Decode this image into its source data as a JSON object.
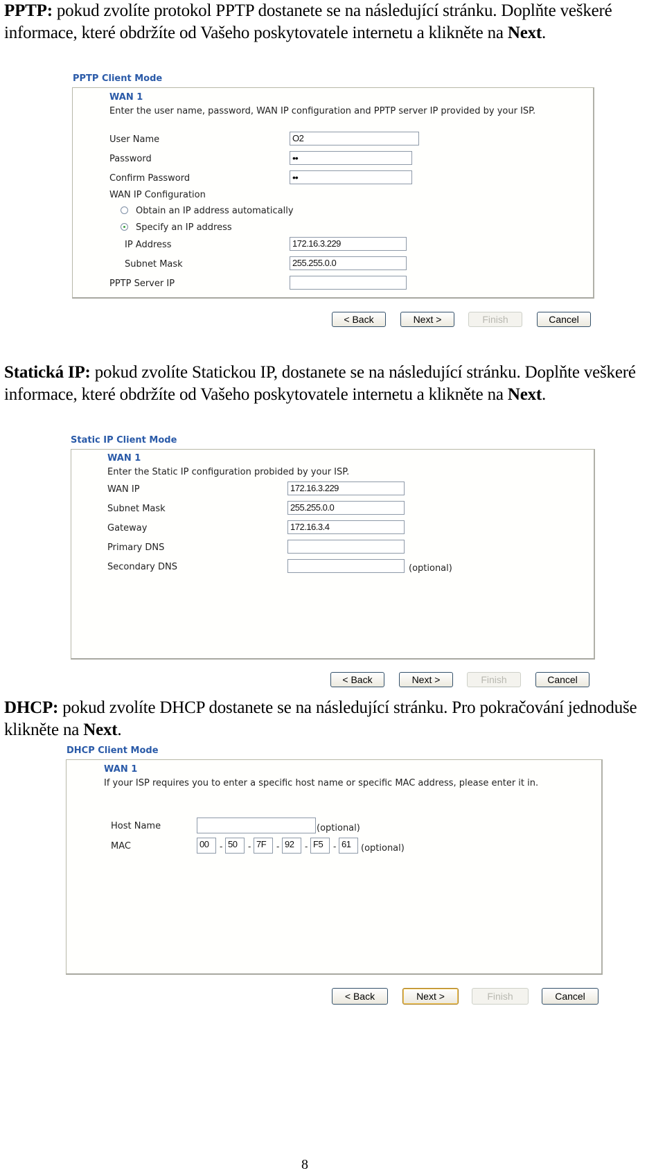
{
  "sections": {
    "pptp": {
      "intro_bold": "PPTP:",
      "intro_text_1": " pokud zvolíte protokol PPTP dostanete se na následující stránku. Doplňte veškeré informace, které obdržíte od Vašeho poskytovatele internetu a klikněte na ",
      "intro_next_bold": "Next",
      "intro_end": ".",
      "panel_title": "PPTP Client Mode",
      "wan_label": "WAN 1",
      "instructions": "Enter the user name, password, WAN IP configuration and PPTP server IP provided by your ISP.",
      "fields": {
        "user_name": {
          "label": "User Name",
          "value": "O2"
        },
        "password": {
          "label": "Password",
          "value": "••"
        },
        "confirm_password": {
          "label": "Confirm Password",
          "value": "••"
        },
        "wan_ip_config_label": "WAN IP Configuration",
        "radio_auto": {
          "label": "Obtain an IP address automatically",
          "selected": false
        },
        "radio_specify": {
          "label": "Specify an IP address",
          "selected": true
        },
        "ip_address": {
          "label": "IP Address",
          "value": "172.16.3.229"
        },
        "subnet_mask": {
          "label": "Subnet Mask",
          "value": "255.255.0.0"
        },
        "pptp_server_ip": {
          "label": "PPTP Server IP",
          "value": ""
        }
      },
      "buttons": {
        "back": "< Back",
        "next": "Next >",
        "finish": "Finish",
        "cancel": "Cancel"
      }
    },
    "static": {
      "intro_bold": "Statická IP:",
      "intro_text_1": " pokud zvolíte Statickou IP, dostanete se na následující stránku. Doplňte veškeré informace, které obdržíte od Vašeho poskytovatele internetu a klikněte na ",
      "intro_next_bold": "Next",
      "intro_end": ".",
      "panel_title": "Static IP Client Mode",
      "wan_label": "WAN 1",
      "instructions": "Enter the Static IP configuration probided by your ISP.",
      "fields": {
        "wan_ip": {
          "label": "WAN IP",
          "value": "172.16.3.229"
        },
        "subnet_mask": {
          "label": "Subnet Mask",
          "value": "255.255.0.0"
        },
        "gateway": {
          "label": "Gateway",
          "value": "172.16.3.4"
        },
        "primary_dns": {
          "label": "Primary DNS",
          "value": ""
        },
        "secondary_dns": {
          "label": "Secondary DNS",
          "value": "",
          "note": "(optional)"
        }
      },
      "buttons": {
        "back": "< Back",
        "next": "Next >",
        "finish": "Finish",
        "cancel": "Cancel"
      }
    },
    "dhcp": {
      "intro_bold": "DHCP:",
      "intro_text_1": " pokud zvolíte DHCP dostanete se na následující stránku. Pro pokračování jednoduše klikněte na ",
      "intro_next_bold": "Next",
      "intro_end": ".",
      "panel_title": "DHCP Client Mode",
      "wan_label": "WAN 1",
      "instructions": "If your ISP requires you to enter a specific host name or specific MAC address, please enter it in.",
      "fields": {
        "host_name": {
          "label": "Host Name",
          "value": "",
          "note": "(optional)"
        },
        "mac": {
          "label": "MAC",
          "octets": [
            "00",
            "50",
            "7F",
            "92",
            "F5",
            "61"
          ],
          "separator": "-",
          "note": "(optional)"
        }
      },
      "buttons": {
        "back": "< Back",
        "next": "Next >",
        "finish": "Finish",
        "cancel": "Cancel"
      }
    }
  },
  "page_number": "8"
}
